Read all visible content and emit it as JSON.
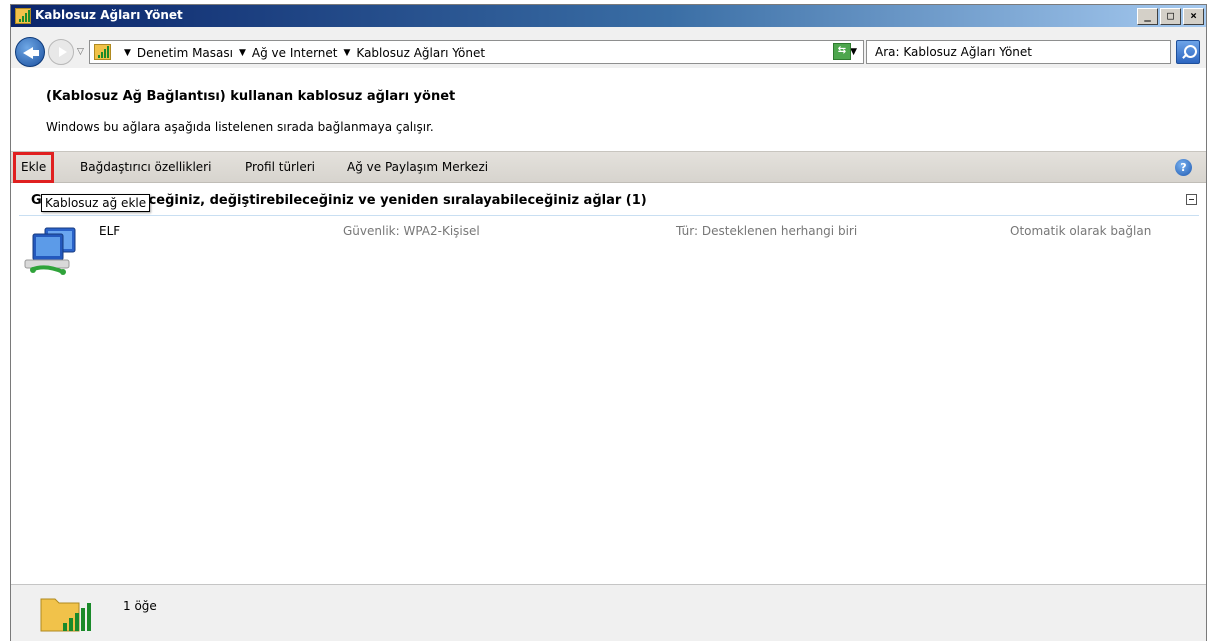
{
  "window": {
    "title": "Kablosuz Ağları Yönet",
    "caption_buttons": {
      "minimize": "_",
      "maximize": "□",
      "close": "×"
    }
  },
  "address_bar": {
    "breadcrumbs": [
      "Denetim Masası",
      "Ağ ve Internet",
      "Kablosuz Ağları Yönet"
    ],
    "search_placeholder": "Ara: Kablosuz Ağları Yönet"
  },
  "content": {
    "heading": "(Kablosuz Ağ Bağlantısı) kullanan kablosuz ağları yönet",
    "subheading": "Windows bu ağlara aşağıda listelenen sırada bağlanmaya çalışır."
  },
  "toolbar": {
    "add": "Ekle",
    "adapter_properties": "Bağdaştırıcı özellikleri",
    "profile_types": "Profil türleri",
    "network_center": "Ağ ve Paylaşım Merkezi",
    "help": "?"
  },
  "tooltip": "Kablosuz ağ ekle",
  "group": {
    "title": "Görüntüleyebileceğiniz, değiştirebileceğiniz ve yeniden sıralayabileceğiniz ağlar (1)"
  },
  "networks": [
    {
      "name": "ELF",
      "security": "Güvenlik:  WPA2-Kişisel",
      "type": "Tür:  Desteklenen herhangi biri",
      "connect": "Otomatik olarak bağlan"
    }
  ],
  "status": {
    "count": "1 öğe"
  },
  "colors": {
    "selected_outline": "#e02020",
    "title_bar": "#0a246a"
  },
  "icons": {
    "title": "wireless-signal-folder-icon",
    "network": "wireless-computers-icon",
    "status": "wireless-signal-folder-icon"
  }
}
